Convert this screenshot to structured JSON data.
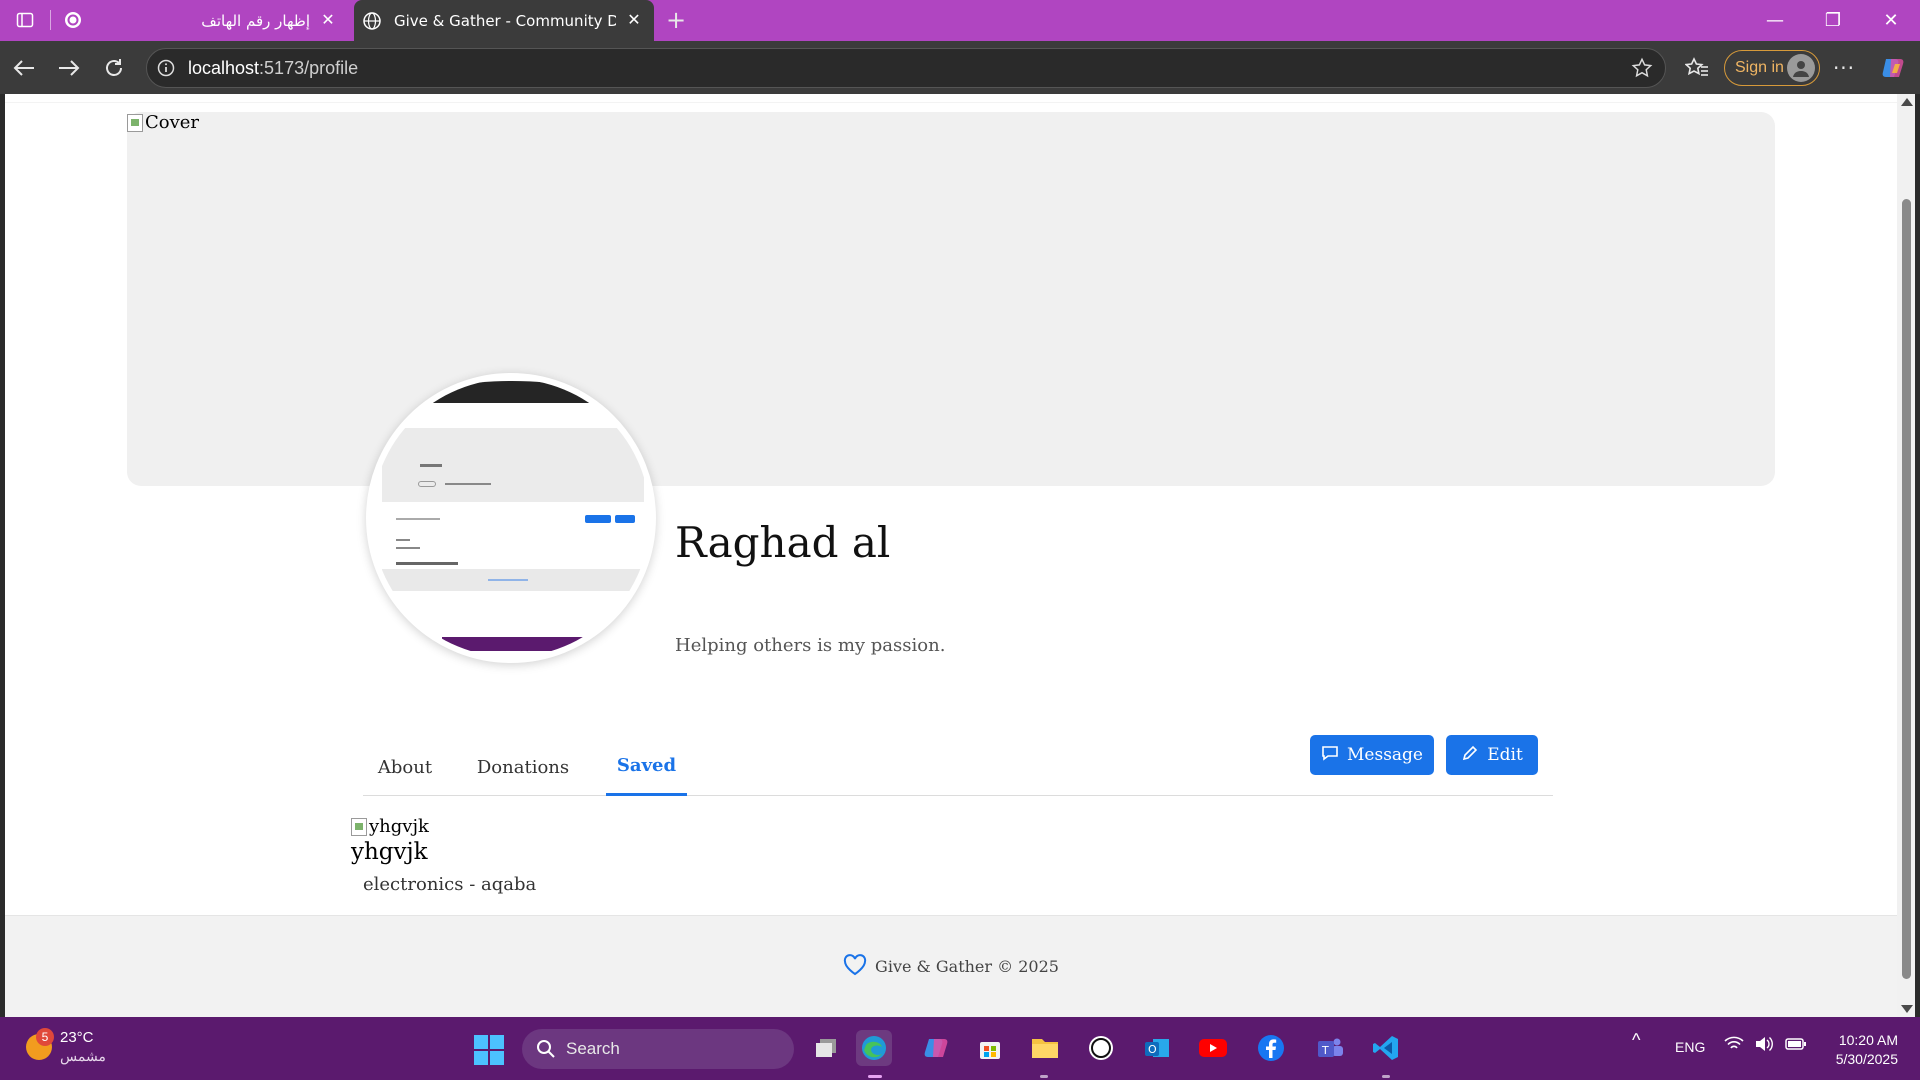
{
  "browser": {
    "tabs": [
      {
        "title": "إظهار رقم الهاتف",
        "active": false
      },
      {
        "title": "Give & Gather - Community Donation",
        "active": true
      }
    ],
    "url_host": "localhost",
    "url_path": ":5173/profile",
    "sign_in_label": "Sign in"
  },
  "profile": {
    "cover_alt": "Cover",
    "name": "Raghad al",
    "bio": "Helping others is my passion.",
    "tabs": [
      "About",
      "Donations",
      "Saved"
    ],
    "active_tab": "Saved",
    "message_label": "Message",
    "edit_label": "Edit"
  },
  "saved_items": [
    {
      "image_alt": "yhgvjk",
      "title": "yhgvjk",
      "subtitle": "electronics - aqaba"
    }
  ],
  "footer": {
    "text": "Give & Gather © 2025"
  },
  "taskbar": {
    "weather_temp": "23°C",
    "weather_condition": "مشمس",
    "weather_badge": "5",
    "search_placeholder": "Search",
    "language": "ENG",
    "time": "10:20 AM",
    "date": "5/30/2025"
  },
  "colors": {
    "accent": "#1a73e8",
    "tabbar": "#b045c1",
    "taskbar": "#5b1a6e"
  }
}
